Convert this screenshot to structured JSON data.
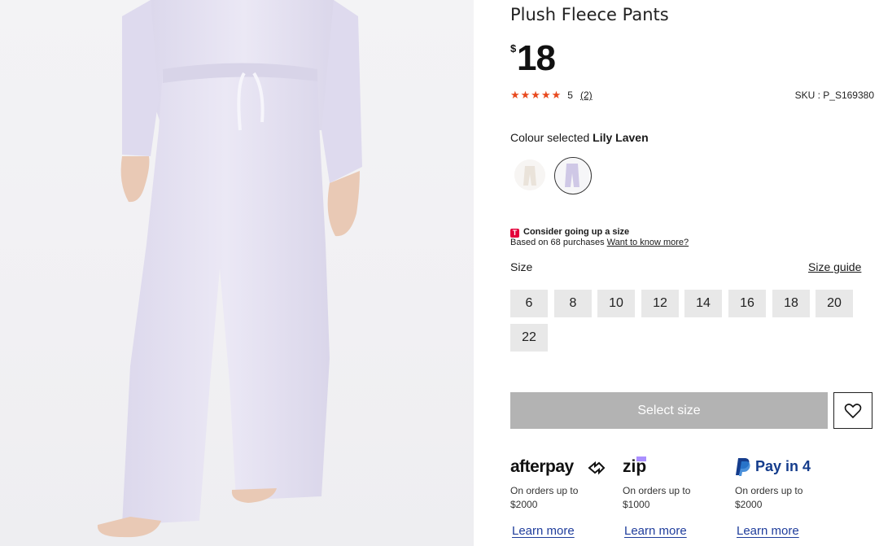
{
  "product": {
    "title": "Plush Fleece Pants",
    "currency": "$",
    "price": "18",
    "stars": "★★★★★",
    "rating": "5",
    "review_count": "(2)",
    "sku": "SKU : P_S169380"
  },
  "colour": {
    "label": "Colour selected",
    "selected": "Lily Laven",
    "swatches": [
      "cream",
      "lilac"
    ]
  },
  "fit": {
    "badge": "T",
    "headline": "Consider going up a size",
    "based_on": "Based on 68 purchases",
    "link": "Want to know more?"
  },
  "size": {
    "label": "Size",
    "guide": "Size guide",
    "options": [
      "6",
      "8",
      "10",
      "12",
      "14",
      "16",
      "18",
      "20",
      "22"
    ]
  },
  "actions": {
    "select_size": "Select size"
  },
  "payments": [
    {
      "brand": "afterpay",
      "line1": "On orders up to",
      "line2": "$2000",
      "learn": "Learn more"
    },
    {
      "brand": "zip",
      "line1": "On orders up to",
      "line2": "$1000",
      "learn": "Learn more"
    },
    {
      "brand": "Pay in 4",
      "line1": "On orders up to",
      "line2": "$2000",
      "learn": "Learn more"
    }
  ],
  "colors": {
    "star": "#e8491d",
    "select_disabled": "#b3b3b3",
    "size_bg": "#e8e8e8",
    "link_blue": "#1f3d9c",
    "paypal_blue": "#143c8c",
    "pants": "#e6e2f2"
  }
}
